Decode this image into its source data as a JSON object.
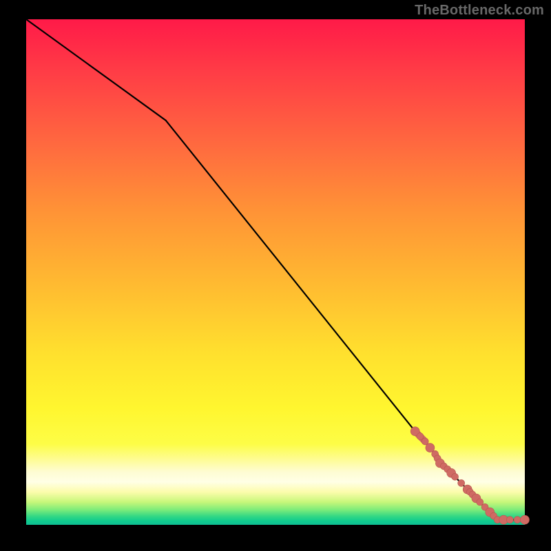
{
  "credit": "TheBottleneck.com",
  "colors": {
    "line": "#000000",
    "marker_fill": "#cf6a63",
    "marker_stroke": "#b85650",
    "bg_top": "#ff1a48",
    "bg_bottom": "#0fbf93"
  },
  "chart_data": {
    "type": "line",
    "title": "",
    "xlabel": "",
    "ylabel": "",
    "xlim": [
      0,
      100
    ],
    "ylim": [
      0,
      100
    ],
    "x": [
      0,
      28,
      78,
      80,
      82,
      83,
      84.5,
      86,
      88.5,
      89.5,
      91,
      93,
      94.5,
      97,
      100
    ],
    "values": [
      100,
      80,
      18.5,
      16.5,
      14,
      12.2,
      11,
      9.5,
      7,
      6,
      4.5,
      2.5,
      1,
      1,
      1
    ],
    "markers_between_index": [
      2,
      14
    ],
    "annotations": []
  }
}
